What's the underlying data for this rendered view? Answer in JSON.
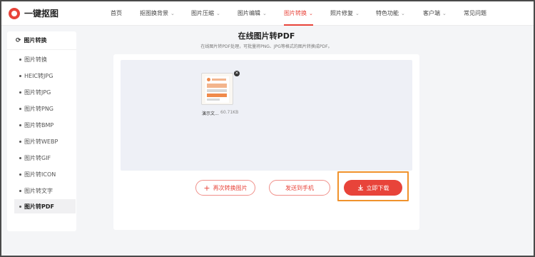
{
  "header": {
    "logo_text": "一键抠图",
    "nav": [
      {
        "label": "首页",
        "dropdown": false,
        "active": false
      },
      {
        "label": "抠图换背景",
        "dropdown": true,
        "active": false
      },
      {
        "label": "图片压缩",
        "dropdown": true,
        "active": false
      },
      {
        "label": "图片编辑",
        "dropdown": true,
        "active": false
      },
      {
        "label": "图片转换",
        "dropdown": true,
        "active": true
      },
      {
        "label": "照片修复",
        "dropdown": true,
        "active": false
      },
      {
        "label": "特色功能",
        "dropdown": true,
        "active": false
      },
      {
        "label": "客户端",
        "dropdown": true,
        "active": false
      },
      {
        "label": "常见问题",
        "dropdown": false,
        "active": false
      }
    ]
  },
  "sidebar": {
    "title": "图片转换",
    "items": [
      {
        "label": "图片转换",
        "active": false
      },
      {
        "label": "HEIC转JPG",
        "active": false
      },
      {
        "label": "图片转JPG",
        "active": false
      },
      {
        "label": "图片转PNG",
        "active": false
      },
      {
        "label": "图片转BMP",
        "active": false
      },
      {
        "label": "图片转WEBP",
        "active": false
      },
      {
        "label": "图片转GIF",
        "active": false
      },
      {
        "label": "图片转ICON",
        "active": false
      },
      {
        "label": "图片转文字",
        "active": false
      },
      {
        "label": "图片转PDF",
        "active": true
      }
    ]
  },
  "main": {
    "title": "在线图片转PDF",
    "subtitle": "在线图片转PDF处理，可批量将PNG、JPG等格式的图片转换成PDF。",
    "file": {
      "name": "演示文...",
      "size": "60.71KB"
    },
    "buttons": {
      "again": "再次转换图片",
      "send": "发送到手机",
      "download": "立即下载"
    }
  },
  "colors": {
    "accent": "#e8443a",
    "highlight": "#f0922c"
  }
}
